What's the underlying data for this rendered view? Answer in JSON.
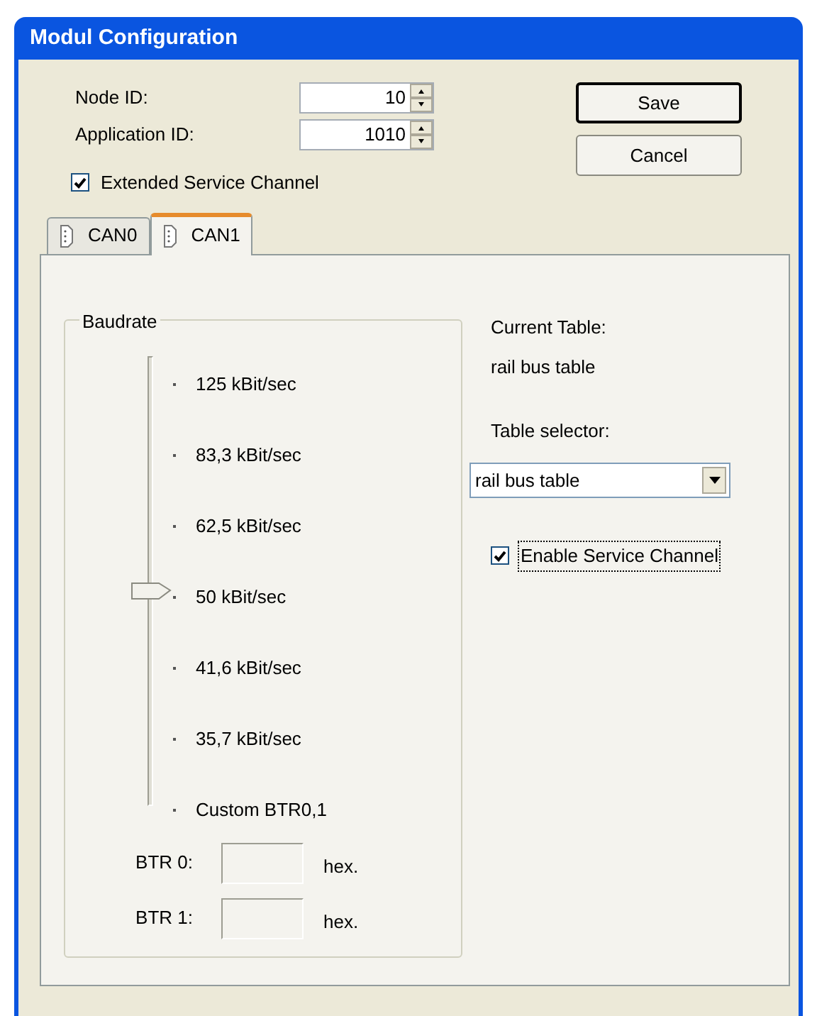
{
  "window": {
    "title": "Modul Configuration"
  },
  "fields": [
    {
      "label": "Node ID:",
      "value": "10"
    },
    {
      "label": "Application ID:",
      "value": "1010"
    }
  ],
  "buttons": [
    {
      "label": "Save",
      "default": true
    },
    {
      "label": "Cancel",
      "default": false
    }
  ],
  "extended_service_channel": {
    "label": "Extended Service Channel",
    "checked": true
  },
  "tabs": [
    {
      "label": "CAN0",
      "selected": false
    },
    {
      "label": "CAN1",
      "selected": true
    }
  ],
  "baudrate": {
    "title": "Baudrate",
    "level": 0.5,
    "options": [
      {
        "label": "125 kBit/sec"
      },
      {
        "label": "83,3 kBit/sec"
      },
      {
        "label": "62,5 kBit/sec"
      },
      {
        "label": "50 kBit/sec"
      },
      {
        "label": "41,6 kBit/sec"
      },
      {
        "label": "35,7 kBit/sec"
      },
      {
        "label": "Custom BTR0,1"
      }
    ],
    "btr_fields": [
      {
        "label": "BTR 0:",
        "unit": "hex."
      },
      {
        "label": "BTR 1:",
        "unit": "hex."
      }
    ]
  },
  "current_table": {
    "label": "Current Table:",
    "value": "rail bus table"
  },
  "table_selector": {
    "label": "Table selector:",
    "value": "rail bus table"
  },
  "enable_service_channel": {
    "label": "Enable Service Channel",
    "checked": true
  }
}
